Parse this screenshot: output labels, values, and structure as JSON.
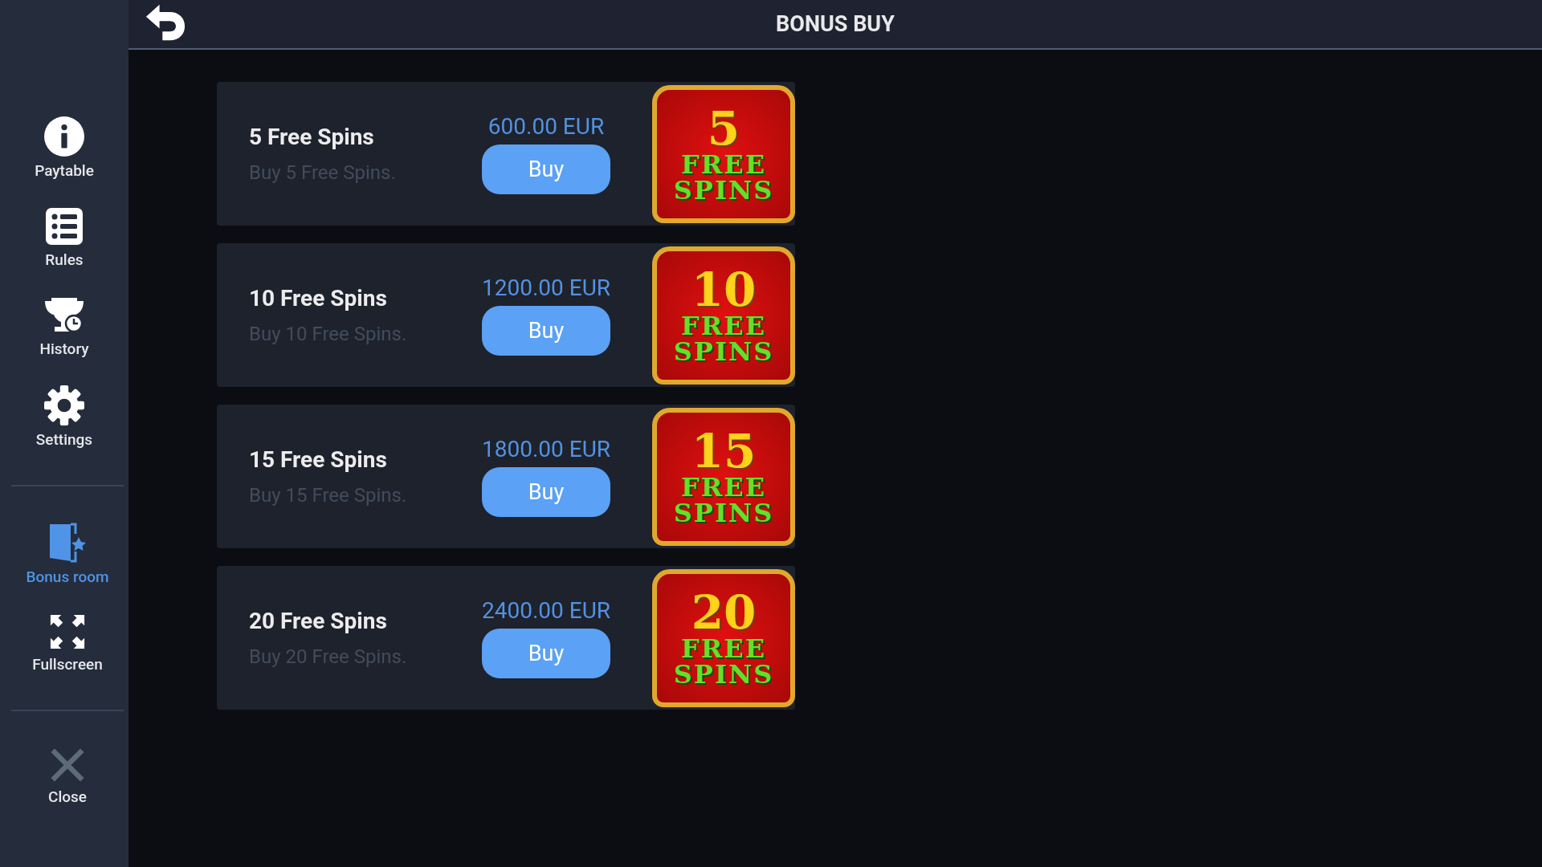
{
  "header": {
    "title": "BONUS BUY"
  },
  "sidebar": {
    "groups": [
      [
        {
          "label": "Paytable",
          "kind": "info",
          "selected": false
        },
        {
          "label": "Rules",
          "kind": "list",
          "selected": false
        },
        {
          "label": "History",
          "kind": "trophy",
          "selected": false
        },
        {
          "label": "Settings",
          "kind": "gear",
          "selected": false
        }
      ],
      [
        {
          "label": "Bonus room",
          "kind": "door",
          "selected": true
        },
        {
          "label": "Fullscreen",
          "kind": "expand",
          "selected": false
        }
      ],
      [
        {
          "label": "Close",
          "kind": "close",
          "selected": false
        }
      ]
    ]
  },
  "offers": [
    {
      "title": "5 Free Spins",
      "description": "Buy 5 Free Spins.",
      "price": "600.00 EUR",
      "button": "Buy",
      "badge_number": "5",
      "badge_line_1": "FREE",
      "badge_line_2": "SPINS"
    },
    {
      "title": "10 Free Spins",
      "description": "Buy 10 Free Spins.",
      "price": "1200.00 EUR",
      "button": "Buy",
      "badge_number": "10",
      "badge_line_1": "FREE",
      "badge_line_2": "SPINS"
    },
    {
      "title": "15 Free Spins",
      "description": "Buy 15 Free Spins.",
      "price": "1800.00 EUR",
      "button": "Buy",
      "badge_number": "15",
      "badge_line_1": "FREE",
      "badge_line_2": "SPINS"
    },
    {
      "title": "20 Free Spins",
      "description": "Buy 20 Free Spins.",
      "price": "2400.00 EUR",
      "button": "Buy",
      "badge_number": "20",
      "badge_line_1": "FREE",
      "badge_line_2": "SPINS"
    }
  ]
}
